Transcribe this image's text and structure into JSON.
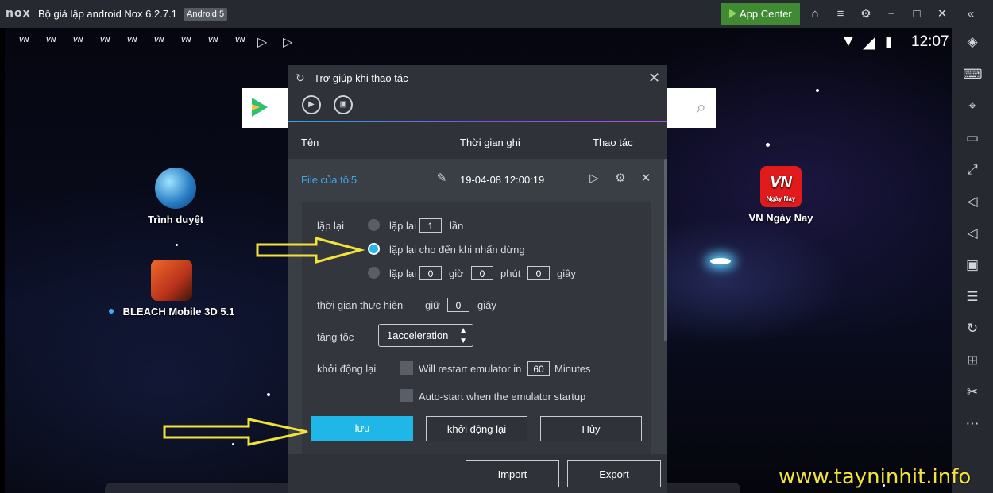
{
  "window": {
    "logo": "nox",
    "title": "Bộ giả lập android Nox 6.2.7.1",
    "android_badge": "Android 5",
    "app_center": "App Center",
    "icons": [
      "shirt-icon",
      "menu-icon",
      "gear-icon",
      "minimize-icon",
      "maximize-icon",
      "close-icon",
      "collapse-icon"
    ]
  },
  "statusbar": {
    "time": "12:07",
    "notification_icons": [
      "vn-ngay-nay-icon",
      "play-store-icon"
    ]
  },
  "desktop": {
    "apps": [
      {
        "label": "Trình duyệt",
        "icon": "globe-icon"
      },
      {
        "label": "BLEACH Mobile 3D 5.1",
        "icon": "bleach-icon"
      },
      {
        "label": "VN Ngày Nay",
        "icon": "vn-ngay-nay-icon",
        "logo_text": "VN",
        "logo_sub": "Ngày Nay"
      }
    ]
  },
  "dialog": {
    "title": "Trợ giúp khi thao tác",
    "columns": {
      "name": "Tên",
      "time": "Thời gian ghi",
      "action": "Thao tác"
    },
    "file": {
      "name": "File của tôi5",
      "date": "19-04-08 12:00:19"
    },
    "repeat": {
      "label": "lặp lại",
      "option1_prefix": "lặp lại",
      "option1_count": "1",
      "option1_suffix": "lần",
      "option2": "lặp lại cho đến khi nhấn dừng",
      "option3_prefix": "lặp lại",
      "hours": "0",
      "hours_unit": "giờ",
      "minutes": "0",
      "minutes_unit": "phút",
      "seconds": "0",
      "seconds_unit": "giây",
      "selected": 2
    },
    "exec_time": {
      "label": "thời gian thực hiện",
      "prefix": "giữ",
      "value": "0",
      "unit": "giây"
    },
    "speed": {
      "label": "tăng tốc",
      "value": "1acceleration"
    },
    "restart": {
      "label": "khởi động lại",
      "opt1_prefix": "Will restart emulator in",
      "opt1_value": "60",
      "opt1_suffix": "Minutes",
      "opt2": "Auto-start when the emulator startup"
    },
    "buttons": {
      "save": "lưu",
      "restart": "khởi động lại",
      "cancel": "Hủy",
      "import": "Import",
      "export": "Export"
    }
  },
  "watermark": "www.tayninhit.info",
  "colors": {
    "accent": "#1eb7e8",
    "app_center": "#3f8a33",
    "file_link": "#3fa8e8",
    "arrow": "#f2e23a"
  }
}
